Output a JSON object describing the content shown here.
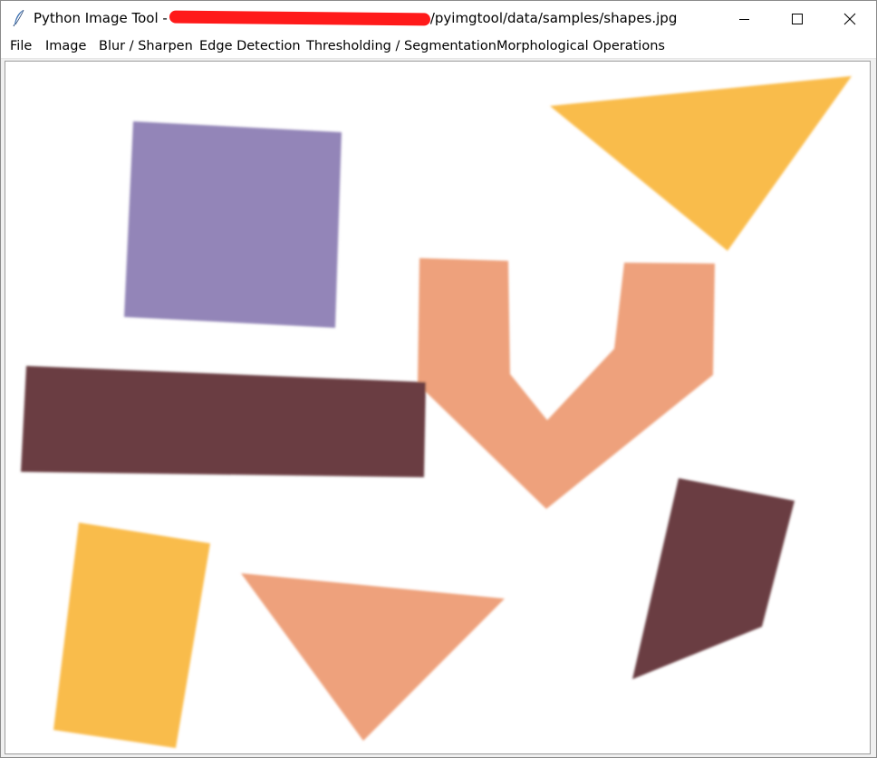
{
  "window": {
    "title_prefix": "Python Image Tool -",
    "title_path_visible": "/pyimgtool/data/samples/shapes.jpg",
    "app_icon": "feather-icon"
  },
  "window_controls": {
    "minimize_icon": "minimize-icon",
    "maximize_icon": "maximize-icon",
    "close_icon": "close-icon"
  },
  "menu": {
    "items": [
      {
        "label": "File"
      },
      {
        "label": "Image"
      },
      {
        "label": "Blur / Sharpen"
      },
      {
        "label": "Edge Detection"
      },
      {
        "label": "Thresholding / Segmentation"
      },
      {
        "label": "Morphological Operations"
      }
    ]
  },
  "colors": {
    "titlebar_bg": "#ffffff",
    "redaction": "#ff1a1a",
    "canvas_bg": "#ffffff",
    "purple_square": "#9385b8",
    "yellow_triangle": "#f9bc4c",
    "orange_v": "#eea17b",
    "brown_bar": "#6b3e42",
    "yellow_quad": "#f9bc4c",
    "orange_triangle": "#eea17b",
    "brown_quad": "#6b3e42"
  }
}
